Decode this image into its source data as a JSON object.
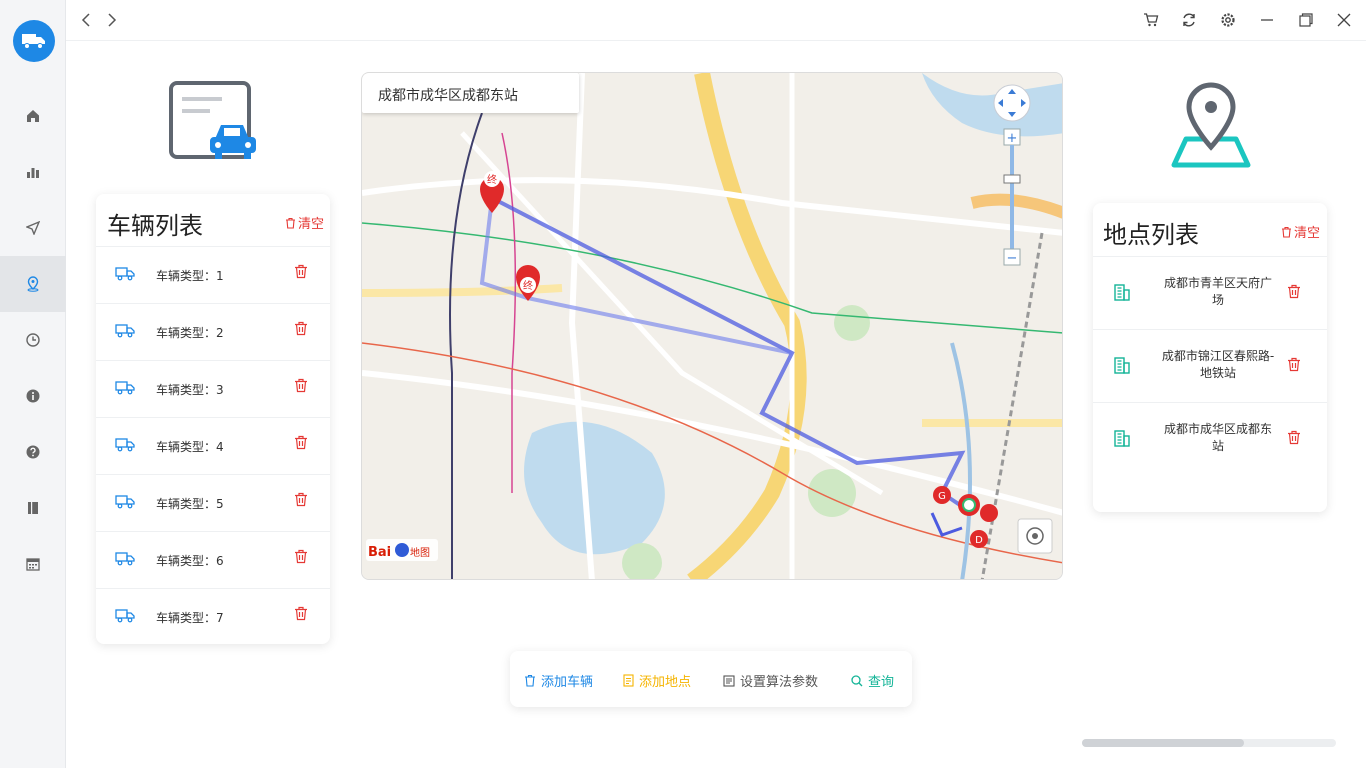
{
  "map": {
    "search_text": "成都市成华区成都东站"
  },
  "vehicles": {
    "title": "车辆列表",
    "clear_label": "清空",
    "items": [
      {
        "label": "车辆类型：1"
      },
      {
        "label": "车辆类型：2"
      },
      {
        "label": "车辆类型：3"
      },
      {
        "label": "车辆类型：4"
      },
      {
        "label": "车辆类型：5"
      },
      {
        "label": "车辆类型：6"
      },
      {
        "label": "车辆类型：7"
      }
    ]
  },
  "locations": {
    "title": "地点列表",
    "clear_label": "清空",
    "items": [
      {
        "line1": "成都市青羊区天府广",
        "line2": "场"
      },
      {
        "line1": "成都市锦江区春熙路-",
        "line2": "地铁站"
      },
      {
        "line1": "成都市成华区成都东",
        "line2": "站"
      }
    ]
  },
  "toolbar": {
    "add_vehicle": "添加车辆",
    "add_location": "添加地点",
    "set_params": "设置算法参数",
    "query": "查询"
  },
  "colors": {
    "accent_blue": "#1e88e5",
    "danger": "#e53935",
    "teal": "#1bb9b4",
    "yellow": "#f5b400",
    "green": "#13b497"
  }
}
